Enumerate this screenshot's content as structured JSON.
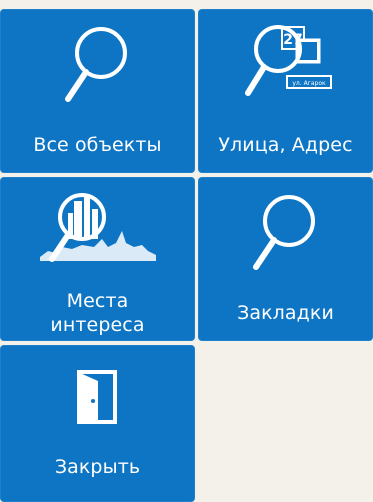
{
  "colors": {
    "tile_background": "#0d75c4",
    "tile_text": "#ffffff",
    "page_background": "#f4f1ea"
  },
  "tiles": [
    {
      "label": "Все объекты",
      "icon": "magnifier-icon"
    },
    {
      "label": "Улица, Адрес",
      "icon": "street-address-search-icon",
      "icon_text": {
        "house_number": "27",
        "street_sign": "ул. Агарок"
      }
    },
    {
      "label_line1": "Места",
      "label_line2": "интереса",
      "icon": "city-search-icon"
    },
    {
      "label": "Закладки",
      "icon": "magnifier-icon"
    },
    {
      "label": "Закрыть",
      "icon": "exit-door-icon"
    }
  ]
}
